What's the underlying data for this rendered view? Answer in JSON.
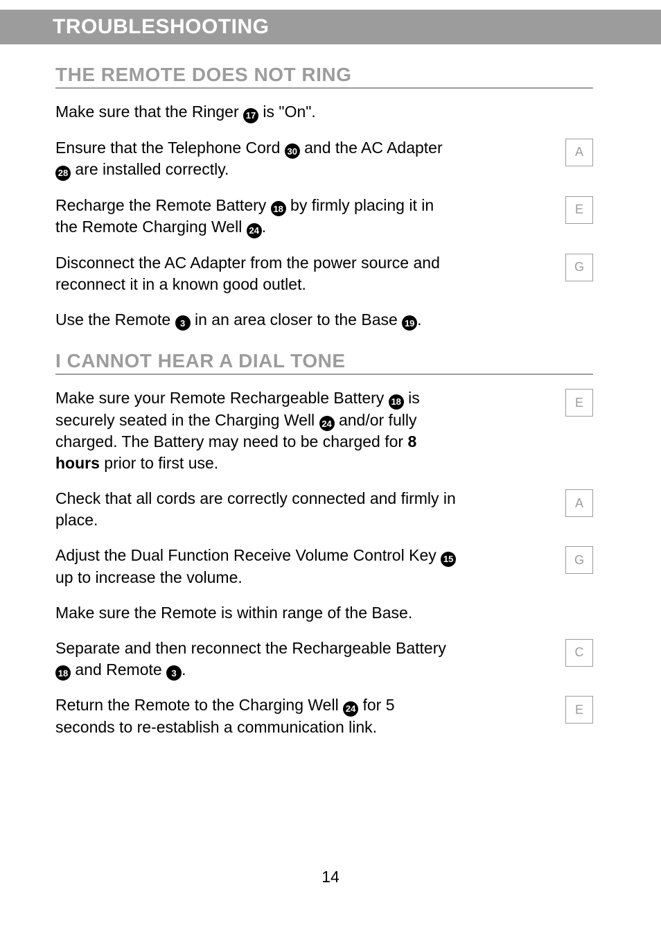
{
  "header": "TROUBLESHOOTING",
  "page_number": "14",
  "sections": [
    {
      "heading": "THE REMOTE DOES NOT RING",
      "items": [
        {
          "segments": [
            {
              "t": "Make sure that the Ringer "
            },
            {
              "c": "17"
            },
            {
              "t": " is \"On\"."
            }
          ],
          "ref": null
        },
        {
          "segments": [
            {
              "t": "Ensure that the Telephone Cord "
            },
            {
              "c": "30"
            },
            {
              "t": " and the AC Adapter "
            },
            {
              "c": "28"
            },
            {
              "t": " are installed correctly."
            }
          ],
          "ref": "A"
        },
        {
          "segments": [
            {
              "t": "Recharge the Remote Battery "
            },
            {
              "c": "18"
            },
            {
              "t": " by firmly placing it in the Remote Charging Well "
            },
            {
              "c": "24"
            },
            {
              "t": "."
            }
          ],
          "ref": "E"
        },
        {
          "segments": [
            {
              "t": "Disconnect the AC Adapter from the power source and reconnect it in a known good outlet."
            }
          ],
          "ref": "G"
        },
        {
          "segments": [
            {
              "t": "Use the Remote "
            },
            {
              "c": "3"
            },
            {
              "t": " in an area closer to the Base "
            },
            {
              "c": "19"
            },
            {
              "t": "."
            }
          ],
          "ref": null
        }
      ]
    },
    {
      "heading": "I CANNOT HEAR A DIAL TONE",
      "items": [
        {
          "segments": [
            {
              "t": "Make sure your Remote Rechargeable Battery "
            },
            {
              "c": "18"
            },
            {
              "t": " is securely seated in the Charging Well "
            },
            {
              "c": "24"
            },
            {
              "t": " and/or fully charged. The Battery may need to be charged for "
            },
            {
              "b": "8 hours"
            },
            {
              "t": " prior to first use."
            }
          ],
          "ref": "E"
        },
        {
          "segments": [
            {
              "t": "Check that all cords are correctly connected and firmly in place."
            }
          ],
          "ref": "A"
        },
        {
          "segments": [
            {
              "t": "Adjust the Dual Function Receive Volume Control Key "
            },
            {
              "c": "15"
            },
            {
              "t": " up to increase the volume."
            }
          ],
          "ref": "G"
        },
        {
          "segments": [
            {
              "t": "Make sure the Remote is within range of the Base."
            }
          ],
          "ref": null
        },
        {
          "segments": [
            {
              "t": "Separate and then reconnect the Rechargeable Battery "
            },
            {
              "c": "18"
            },
            {
              "t": " and Remote "
            },
            {
              "c": "3"
            },
            {
              "t": "."
            }
          ],
          "ref": "C"
        },
        {
          "segments": [
            {
              "t": "Return the Remote to the Charging Well "
            },
            {
              "c": "24"
            },
            {
              "t": " for 5 seconds to re-establish a communication link."
            }
          ],
          "ref": "E"
        }
      ]
    }
  ]
}
